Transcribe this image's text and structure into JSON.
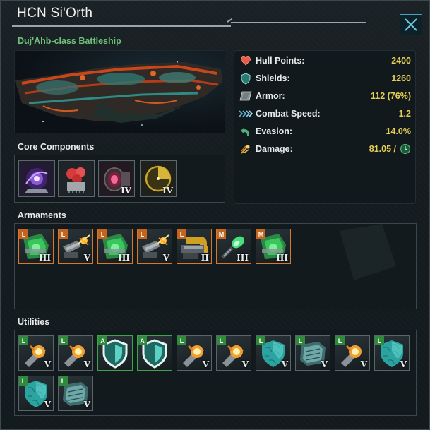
{
  "window": {
    "title": "HCN Si'Orth",
    "subtitle": "Duj'Ahb-class Battleship",
    "close_icon": "close-icon"
  },
  "stats": [
    {
      "label": "Hull Points:",
      "value": "2400",
      "icon": "heart-icon",
      "color": "#e85a4a"
    },
    {
      "label": "Shields:",
      "value": "1260",
      "icon": "shield-icon",
      "color": "#3fa89a"
    },
    {
      "label": "Armor:",
      "value": "112 (76%)",
      "icon": "armor-icon",
      "color": "#9aa2a6"
    },
    {
      "label": "Combat Speed:",
      "value": "1.2",
      "icon": "speed-icon",
      "color": "#5fb6d6"
    },
    {
      "label": "Evasion:",
      "value": "14.0%",
      "icon": "evasion-icon",
      "color": "#4fae7e"
    },
    {
      "label": "Damage:",
      "value": "81.05 /",
      "icon": "damage-icon",
      "color": "#e0a030"
    }
  ],
  "sections": {
    "core": "Core Components",
    "armaments": "Armaments",
    "utilities": "Utilities"
  },
  "core_components": [
    {
      "icon": "reactor-icon",
      "tier": ""
    },
    {
      "icon": "computer-icon",
      "tier": ""
    },
    {
      "icon": "thruster-icon",
      "tier": "IV"
    },
    {
      "icon": "sensor-icon",
      "tier": "IV"
    }
  ],
  "armaments": [
    {
      "icon": "green-energy-weapon-icon",
      "size": "L",
      "tier": "III"
    },
    {
      "icon": "kinetic-cannon-icon",
      "size": "L",
      "tier": "V"
    },
    {
      "icon": "green-energy-weapon-icon",
      "size": "L",
      "tier": "III"
    },
    {
      "icon": "kinetic-cannon-icon",
      "size": "L",
      "tier": "V"
    },
    {
      "icon": "mass-driver-icon",
      "size": "L",
      "tier": "II"
    },
    {
      "icon": "plasma-bolt-icon",
      "size": "M",
      "tier": "III"
    },
    {
      "icon": "green-energy-weapon-icon",
      "size": "M",
      "tier": "III"
    }
  ],
  "utilities": [
    {
      "icon": "reactor-booster-icon",
      "size": "L",
      "tier": "V",
      "color": "orange"
    },
    {
      "icon": "reactor-booster-icon",
      "size": "L",
      "tier": "V",
      "color": "orange"
    },
    {
      "icon": "auxiliary-shield-icon",
      "size": "A",
      "tier": "",
      "color": "green"
    },
    {
      "icon": "auxiliary-shield-icon",
      "size": "A",
      "tier": "",
      "color": "green"
    },
    {
      "icon": "reactor-booster-icon",
      "size": "L",
      "tier": "V",
      "color": "orange"
    },
    {
      "icon": "reactor-booster-icon",
      "size": "L",
      "tier": "V",
      "color": "orange"
    },
    {
      "icon": "hex-shield-icon",
      "size": "L",
      "tier": "V",
      "color": "teal"
    },
    {
      "icon": "armor-plate-icon",
      "size": "L",
      "tier": "V",
      "color": "teal"
    },
    {
      "icon": "reactor-booster-icon",
      "size": "L",
      "tier": "V",
      "color": "orange"
    },
    {
      "icon": "hex-shield-icon",
      "size": "L",
      "tier": "V",
      "color": "teal"
    },
    {
      "icon": "hex-shield-icon",
      "size": "L",
      "tier": "V",
      "color": "teal"
    },
    {
      "icon": "armor-plate-icon",
      "size": "L",
      "tier": "V",
      "color": "teal"
    }
  ]
}
